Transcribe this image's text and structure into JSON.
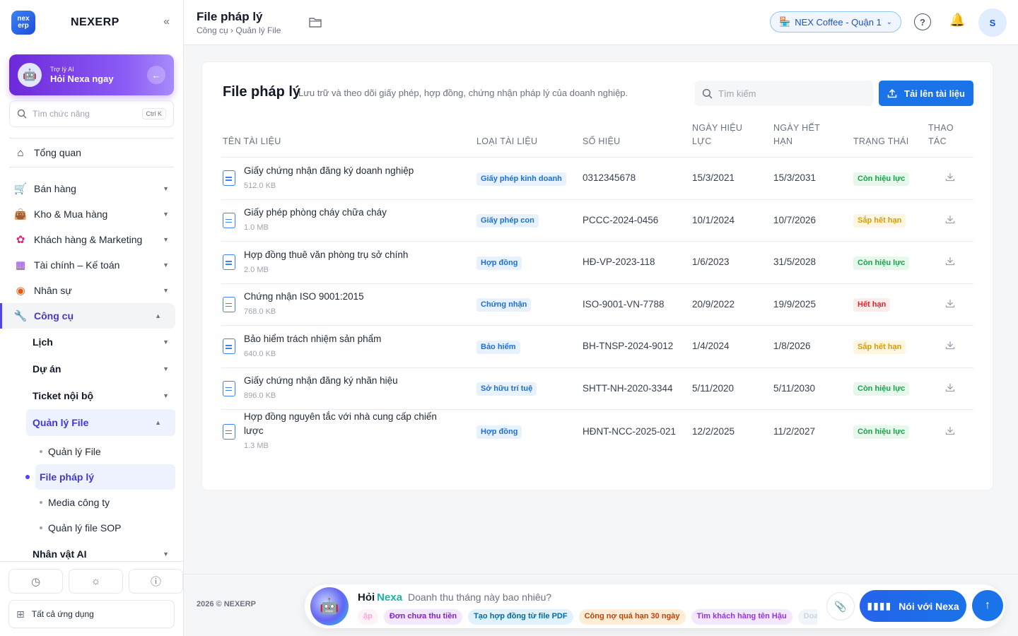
{
  "sidebar": {
    "brand": "NEXERP",
    "logo_top": "nex",
    "logo_bottom": "erp",
    "collapse_icon": "«",
    "ai": {
      "sub": "Trợ lý AI",
      "main": "Hỏi Nexa ngay"
    },
    "search": {
      "placeholder": "Tìm chức năng",
      "shortcut": "Ctrl K"
    },
    "overview": "Tổng quan",
    "sections": [
      {
        "label": "Bán hàng"
      },
      {
        "label": "Kho & Mua hàng"
      },
      {
        "label": "Khách hàng & Marketing"
      },
      {
        "label": "Tài chính – Kế toán"
      },
      {
        "label": "Nhân sự"
      },
      {
        "label": "Công cụ"
      }
    ],
    "tools_sub": [
      {
        "label": "Lịch"
      },
      {
        "label": "Dự án"
      },
      {
        "label": "Ticket nội bộ"
      },
      {
        "label": "Quản lý File"
      }
    ],
    "file_leaves": [
      {
        "label": "Quản lý File"
      },
      {
        "label": "File pháp lý"
      },
      {
        "label": "Media công ty"
      },
      {
        "label": "Quản lý file SOP"
      }
    ],
    "next_item": "Nhân vật AI",
    "all_apps": "Tất cả ứng dụng"
  },
  "header": {
    "title": "File pháp lý",
    "breadcrumb": "Công cụ › Quản lý File",
    "store": "NEX Coffee - Quận 1",
    "avatar": "S"
  },
  "card": {
    "title": "File pháp lý",
    "description": "Lưu trữ và theo dõi giấy phép, hợp đồng, chứng nhận pháp lý của doanh nghiệp.",
    "search_placeholder": "Tìm kiếm",
    "upload_label": "Tải lên tài liệu",
    "columns": {
      "name": "Tên tài liệu",
      "type": "Loại tài liệu",
      "number": "Số hiệu",
      "effective": "Ngày hiệu lực",
      "expiry": "Ngày hết hạn",
      "status": "Trạng thái",
      "actions": "Thao tác"
    },
    "rows": [
      {
        "name": "Giấy chứng nhận đăng ký doanh nghiệp",
        "size": "512.0 KB",
        "type": "Giấy phép kinh doanh",
        "number": "0312345678",
        "effective": "15/3/2021",
        "expiry": "15/3/2031",
        "status": "Còn hiệu lực"
      },
      {
        "name": "Giấy phép phòng cháy chữa cháy",
        "size": "1.0 MB",
        "type": "Giấy phép con",
        "number": "PCCC-2024-0456",
        "effective": "10/1/2024",
        "expiry": "10/7/2026",
        "status": "Sắp hết hạn"
      },
      {
        "name": "Hợp đồng thuê văn phòng trụ sở chính",
        "size": "2.0 MB",
        "type": "Hợp đồng",
        "number": "HĐ-VP-2023-118",
        "effective": "1/6/2023",
        "expiry": "31/5/2028",
        "status": "Còn hiệu lực"
      },
      {
        "name": "Chứng nhận ISO 9001:2015",
        "size": "768.0 KB",
        "type": "Chứng nhận",
        "number": "ISO-9001-VN-7788",
        "effective": "20/9/2022",
        "expiry": "19/9/2025",
        "status": "Hết hạn"
      },
      {
        "name": "Bảo hiểm trách nhiệm sản phẩm",
        "size": "640.0 KB",
        "type": "Bảo hiểm",
        "number": "BH-TNSP-2024-9012",
        "effective": "1/4/2024",
        "expiry": "1/8/2026",
        "status": "Sắp hết hạn"
      },
      {
        "name": "Giấy chứng nhận đăng ký nhãn hiệu",
        "size": "896.0 KB",
        "type": "Sở hữu trí tuệ",
        "number": "SHTT-NH-2020-3344",
        "effective": "5/11/2020",
        "expiry": "5/11/2030",
        "status": "Còn hiệu lực"
      },
      {
        "name": "Hợp đồng nguyên tắc với nhà cung cấp chiến lược",
        "size": "1.3 MB",
        "type": "Hợp đồng",
        "number": "HĐNT-NCC-2025-021",
        "effective": "12/2/2025",
        "expiry": "11/2/2027",
        "status": "Còn hiệu lực"
      }
    ]
  },
  "status_colors": {
    "Còn hiệu lực": "#16a34a",
    "Sắp hết hạn": "#d99a06",
    "Hết hạn": "#dc2626"
  },
  "footer": {
    "copyright": "2026 © NEXERP",
    "ask": "Hỏi",
    "nexa": "Nexa",
    "placeholder": "Doanh thu tháng này bao nhiêu?",
    "chips": [
      "ập",
      "Đơn chưa thu tiền",
      "Tạo hợp đồng từ file PDF",
      "Công nợ quá hạn 30 ngày",
      "Tìm khách hàng tên Hậu",
      "Doa"
    ],
    "speak_label": "Nói với Nexa"
  }
}
